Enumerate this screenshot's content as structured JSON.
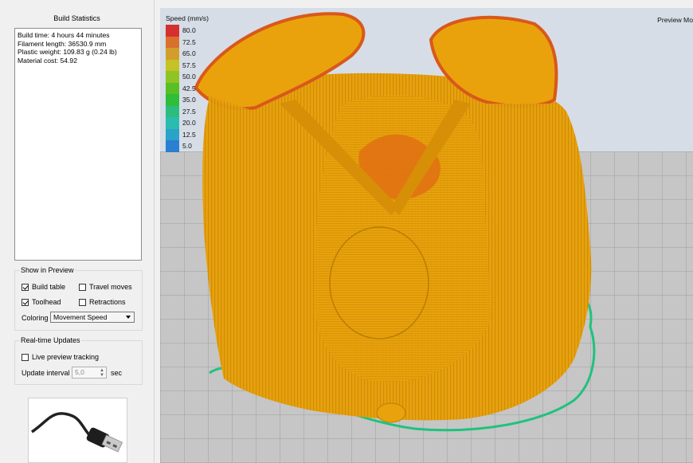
{
  "build_statistics": {
    "title": "Build Statistics",
    "lines": [
      "Build time: 4 hours 44 minutes",
      "Filament length: 36530.9 mm",
      "Plastic weight: 109.83 g (0.24 lb)",
      "Material cost: 54.92"
    ]
  },
  "show_in_preview": {
    "title": "Show in Preview",
    "build_table": {
      "label": "Build table",
      "checked": true
    },
    "travel_moves": {
      "label": "Travel moves",
      "checked": false
    },
    "toolhead": {
      "label": "Toolhead",
      "checked": true
    },
    "retractions": {
      "label": "Retractions",
      "checked": false
    },
    "coloring_label": "Coloring",
    "coloring_value": "Movement Speed"
  },
  "realtime_updates": {
    "title": "Real-time Updates",
    "live_preview": {
      "label": "Live preview tracking",
      "checked": false
    },
    "update_interval_label": "Update interval",
    "update_interval_value": "5,0",
    "update_interval_unit": "sec"
  },
  "viewport": {
    "legend_title": "Speed (mm/s)",
    "legend": [
      {
        "value": "80.0",
        "color": "#d62f2f"
      },
      {
        "value": "72.5",
        "color": "#d8702e"
      },
      {
        "value": "65.0",
        "color": "#d39d2b"
      },
      {
        "value": "57.5",
        "color": "#c4c224"
      },
      {
        "value": "50.0",
        "color": "#8fc424"
      },
      {
        "value": "42.5",
        "color": "#58c024"
      },
      {
        "value": "35.0",
        "color": "#2fbd3a"
      },
      {
        "value": "27.5",
        "color": "#2cbd7d"
      },
      {
        "value": "20.0",
        "color": "#2bbcb0"
      },
      {
        "value": "12.5",
        "color": "#2aa3c8"
      },
      {
        "value": "5.0",
        "color": "#2a7fd0"
      }
    ],
    "mode_label": "Preview Mo",
    "model_color": "#e9a20c",
    "skirt_color": "#1fc27e",
    "bed_color": "#c4c4c4"
  }
}
